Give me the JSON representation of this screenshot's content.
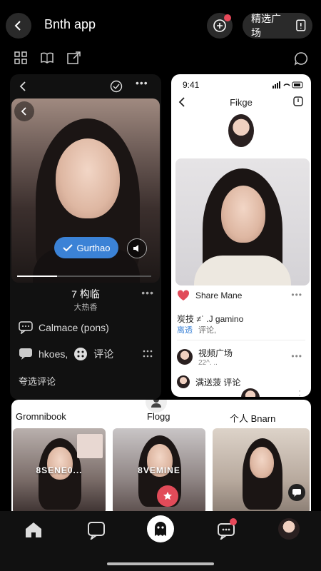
{
  "app": {
    "title": "Bnth app"
  },
  "header": {
    "pill_label": "精选广场"
  },
  "left_panel": {
    "follow_label": "Gurthao",
    "progress": 0.3,
    "name": "7 构临",
    "subtitle": "大热香",
    "row1": "Calmace (pons)",
    "row2_a": "hkoes,",
    "row2_b": "评论",
    "row3": "夸选评论"
  },
  "right_panel": {
    "time": "9:41",
    "title": "Fikge",
    "share_label": "Share Mane",
    "comment_line": "炭技 ≠ˈ .J gamino",
    "comment_link": "离透",
    "comment_sub": "评论,",
    "item1_title": "视频广场",
    "item1_sub": "22^. ..",
    "item2_title": "满送菠 评论"
  },
  "bottom_panel": {
    "left_heading": "Gromnibook",
    "mid_heading": "Flogg",
    "right_heading": "个人 Bnarn",
    "tile1_caption": "8SENE0...",
    "tile2_caption": "8VEMINE"
  },
  "colors": {
    "accent_blue": "#3b82d6",
    "badge_red": "#e8495a",
    "heart_red": "#e14b59"
  },
  "icons": [
    "back-icon",
    "add-icon",
    "bookmark-icon",
    "grid-icon",
    "book-icon",
    "share-icon",
    "chat-icon",
    "home-icon",
    "message-icon",
    "ghost-icon",
    "chat-bubble-icon"
  ]
}
